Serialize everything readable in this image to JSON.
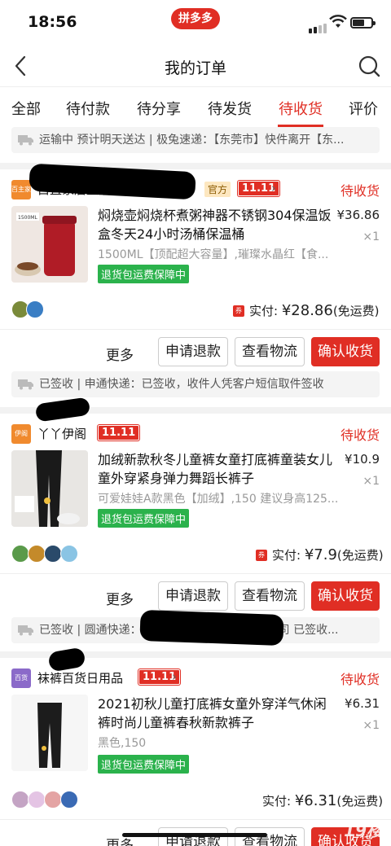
{
  "status_bar": {
    "time": "18:56",
    "app_name": "拼多多"
  },
  "nav": {
    "title": "我的订单",
    "back_icon": "chevron-left-icon",
    "search_icon": "search-icon"
  },
  "tabs": [
    {
      "label": "全部",
      "active": false
    },
    {
      "label": "待付款",
      "active": false
    },
    {
      "label": "待分享",
      "active": false
    },
    {
      "label": "待发货",
      "active": false
    },
    {
      "label": "待收货",
      "active": true
    },
    {
      "label": "评价",
      "active": false
    }
  ],
  "top_tracking": "运输中 预计明天送达 | 极兔速递：【东莞市】快件离开【东...",
  "orders": [
    {
      "shop_name": "白直家居生活官方旗舰店",
      "shop_logo_text": "百主家",
      "official_badge": "官方",
      "promo_badge": "11.11",
      "status": "待收货",
      "product_title": "焖烧壶焖烧杯煮粥神器不锈钢304保温饭盒冬天24小时汤桶保温桶",
      "thumb_label": "1500ML",
      "price": "¥36.86",
      "qty": "×1",
      "spec": "1500ML【顶配超大容量】,璀璨水晶红【食...",
      "guarantee": "退货包运费保障中",
      "coupon": "券",
      "paid_label": "实付:",
      "paid_amount": "¥28.86",
      "paid_note": "(免运费)",
      "more": "更多",
      "buttons": [
        "申请退款",
        "查看物流",
        "确认收货"
      ],
      "tracking": "已签收 | 申通快递：已签收，收件人凭客户短信取件签收"
    },
    {
      "shop_name": "丫丫伊阁",
      "shop_logo_text": "伊阁",
      "promo_badge": "11.11",
      "status": "待收货",
      "product_title": "加绒新款秋冬儿童裤女童打底裤童装女儿童外穿紧身弹力舞蹈长裤子",
      "price": "¥10.9",
      "qty": "×1",
      "spec": "可爱娃娃A款黑色【加绒】,150 建议身高125...",
      "guarantee": "退货包运费保障中",
      "coupon": "券",
      "paid_label": "实付:",
      "paid_amount": "¥7.9",
      "paid_note": "(免运费)",
      "more": "更多",
      "buttons": [
        "申请退款",
        "查看物流",
        "确认收货"
      ],
      "tracking": "已签收 | 圆通快递：江苏省苏州市吴江市盛泽公司 已签收..."
    },
    {
      "shop_name": "袜裤百货日用品",
      "shop_logo_text": "百货",
      "promo_badge": "11.11",
      "status": "待收货",
      "product_title": "2021初秋儿童打底裤女童外穿洋气休闲裤时尚儿童裤春秋新款裤子",
      "price": "¥6.31",
      "qty": "×1",
      "spec": "黑色,150",
      "guarantee": "退货包运费保障中",
      "paid_label": "实付:",
      "paid_amount": "¥6.31",
      "paid_note": "(免运费)",
      "more": "更多",
      "buttons": [
        "申请退款",
        "查看物流",
        "确认收货"
      ]
    }
  ],
  "watermark": "19楼",
  "colors": {
    "brand": "#e02e24",
    "guarantee": "#2bb24c"
  }
}
